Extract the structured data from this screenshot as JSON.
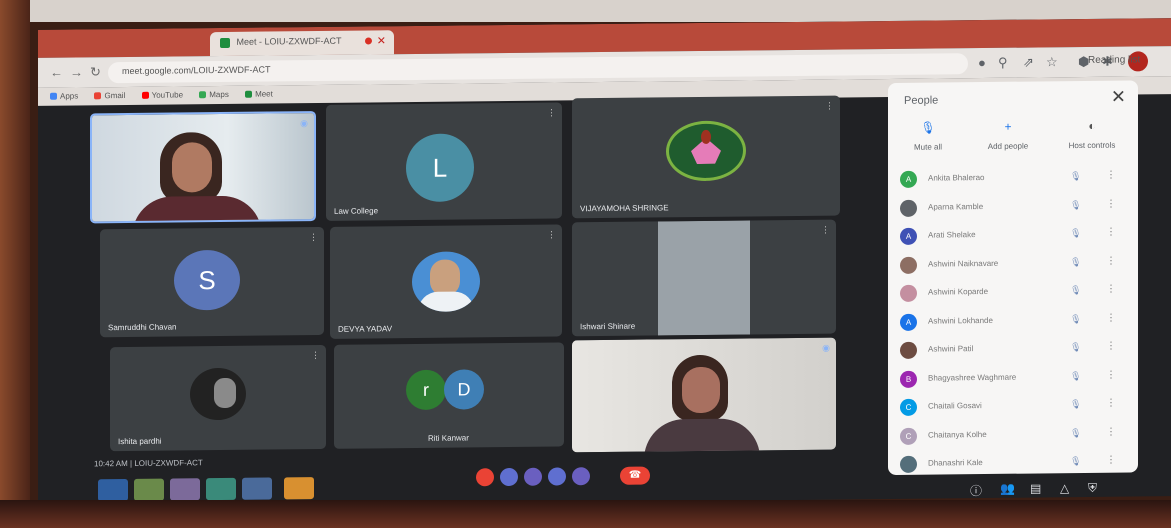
{
  "browser": {
    "tab_title": "Meet - LOIU-ZXWDF-ACT",
    "url": "meet.google.com/LOIU-ZXWDF-ACT",
    "reading_list": "Reading list",
    "bookmarks": [
      {
        "label": "Apps",
        "color": "#4285f4"
      },
      {
        "label": "Gmail",
        "color": "#ea4335"
      },
      {
        "label": "YouTube",
        "color": "#ff0000"
      },
      {
        "label": "Maps",
        "color": "#34a853"
      },
      {
        "label": "Meet",
        "color": "#1e8e3e"
      },
      {
        "label": "Reading list",
        "color": "#5f6368"
      }
    ]
  },
  "tiles": [
    {
      "name": "",
      "kind": "video-woman"
    },
    {
      "name": "Law College",
      "kind": "letter",
      "letter": "L",
      "color": "#4a8fa4"
    },
    {
      "name": "VIJAYAMOHA SHRINGE",
      "kind": "logo"
    },
    {
      "name": "Samruddhi Chavan",
      "kind": "letter",
      "letter": "S",
      "color": "#5b76b8"
    },
    {
      "name": "DEVYA YADAV",
      "kind": "photo"
    },
    {
      "name": "Ishwari Shinare",
      "kind": "wall"
    },
    {
      "name": "Ishita pardhi",
      "kind": "photo-dark"
    },
    {
      "name": "Riti Kanwar",
      "kind": "two-letters",
      "letters": [
        "r",
        "D"
      ]
    },
    {
      "name": "",
      "kind": "video-woman2"
    }
  ],
  "meeting": {
    "info": "10:42 AM  |  LOIU-ZXWDF-ACT"
  },
  "panel": {
    "title": "People",
    "actions": [
      {
        "label": "Mute all",
        "icon": "mic-off-icon"
      },
      {
        "label": "Add people",
        "icon": "add-person-icon"
      },
      {
        "label": "Host controls",
        "icon": "toggle-icon"
      }
    ],
    "participants": [
      {
        "name": "Ankita Bhalerao",
        "initial": "A",
        "color": "#34a853"
      },
      {
        "name": "Aparna Kamble",
        "initial": "",
        "color": "#5f6368"
      },
      {
        "name": "Arati Shelake",
        "initial": "A",
        "color": "#3f51b5"
      },
      {
        "name": "Ashwini Naiknavare",
        "initial": "",
        "color": "#8d6e63"
      },
      {
        "name": "Ashwini Koparde",
        "initial": "",
        "color": "#c48fa0"
      },
      {
        "name": "Ashwini Lokhande",
        "initial": "A",
        "color": "#1a73e8"
      },
      {
        "name": "Ashwini Patil",
        "initial": "",
        "color": "#6d4c41"
      },
      {
        "name": "Bhagyashree Waghmare",
        "initial": "B",
        "color": "#9c27b0"
      },
      {
        "name": "Chaitali Gosavi",
        "initial": "C",
        "color": "#039be5"
      },
      {
        "name": "Chaitanya Kolhe",
        "initial": "C",
        "color": "#b0a0b8"
      },
      {
        "name": "Dhanashri Kale",
        "initial": "",
        "color": "#546e7a"
      }
    ]
  }
}
